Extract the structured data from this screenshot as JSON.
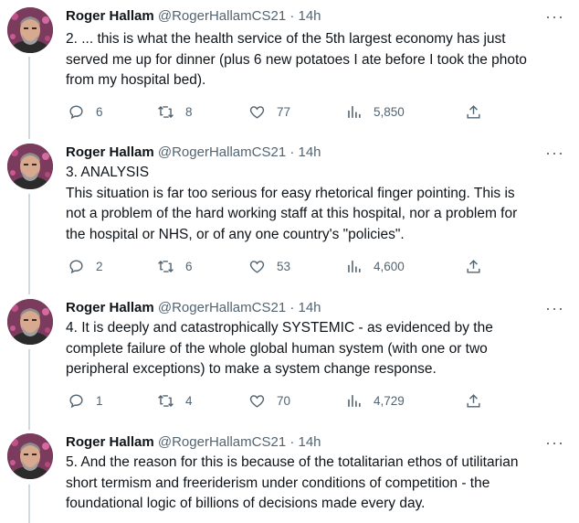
{
  "tweets": [
    {
      "author_name": "Roger Hallam",
      "handle": "@RogerHallamCS21",
      "time": "· 14h",
      "more_label": "···",
      "text_lines": [
        "2. ... this is what the health service of the 5th largest economy has just",
        "served me up for dinner (plus 6 new potatoes I ate before I took the photo",
        "from my hospital bed)."
      ],
      "replies": "6",
      "retweets": "8",
      "likes": "77",
      "views": "5,850"
    },
    {
      "author_name": "Roger Hallam",
      "handle": "@RogerHallamCS21",
      "time": "· 14h",
      "more_label": "···",
      "text_lines": [
        "3. ANALYSIS",
        "This situation is far too serious for easy rhetorical finger pointing. This is",
        "not a problem of the hard working staff at this hospital, nor a problem for",
        "the hospital or NHS, or of any one country's \"policies\"."
      ],
      "replies": "2",
      "retweets": "6",
      "likes": "53",
      "views": "4,600"
    },
    {
      "author_name": "Roger Hallam",
      "handle": "@RogerHallamCS21",
      "time": "· 14h",
      "more_label": "···",
      "text_lines": [
        "4. It is deeply and catastrophically SYSTEMIC - as evidenced by the",
        "complete failure of the whole global human system (with one or two",
        "peripheral exceptions) to make a system change response."
      ],
      "replies": "1",
      "retweets": "4",
      "likes": "70",
      "views": "4,729"
    },
    {
      "author_name": "Roger Hallam",
      "handle": "@RogerHallamCS21",
      "time": "· 14h",
      "more_label": "···",
      "text_lines": [
        "5.  And the reason for this is because of the totalitarian ethos of utilitarian",
        "short termism and freeriderism under conditions of competition - the",
        "foundational logic of billions of decisions made every day."
      ]
    }
  ],
  "icons": {
    "reply": "reply-icon",
    "retweet": "retweet-icon",
    "like": "heart-icon",
    "views": "views-chart-icon",
    "share": "share-icon",
    "more": "more-options-icon"
  },
  "colors": {
    "text": "#0f1419",
    "secondary": "#536471",
    "thread_line": "#cfd9de",
    "background": "#ffffff"
  }
}
